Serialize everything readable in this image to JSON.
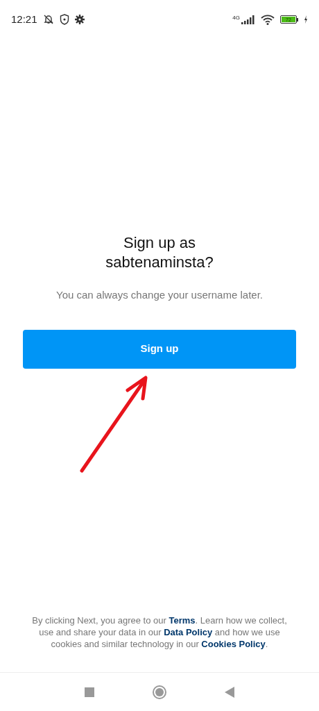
{
  "status_bar": {
    "time": "12:21",
    "network": "4G",
    "battery": "72"
  },
  "title": "Sign up as sabtenaminsta?",
  "subtitle": "You can always change your username later.",
  "signup_button": "Sign up",
  "annotation": {
    "kind": "arrow"
  },
  "footer": [
    {
      "kind": "text",
      "text": "By clicking Next, you agree to our "
    },
    {
      "kind": "link",
      "text": "Terms"
    },
    {
      "kind": "text",
      "text": ". Learn how we collect, use and share your data in our "
    },
    {
      "kind": "link",
      "text": "Data Policy"
    },
    {
      "kind": "text",
      "text": " and how we use cookies and similar technology in our "
    },
    {
      "kind": "link",
      "text": "Cookies Policy"
    },
    {
      "kind": "text",
      "text": "."
    }
  ]
}
